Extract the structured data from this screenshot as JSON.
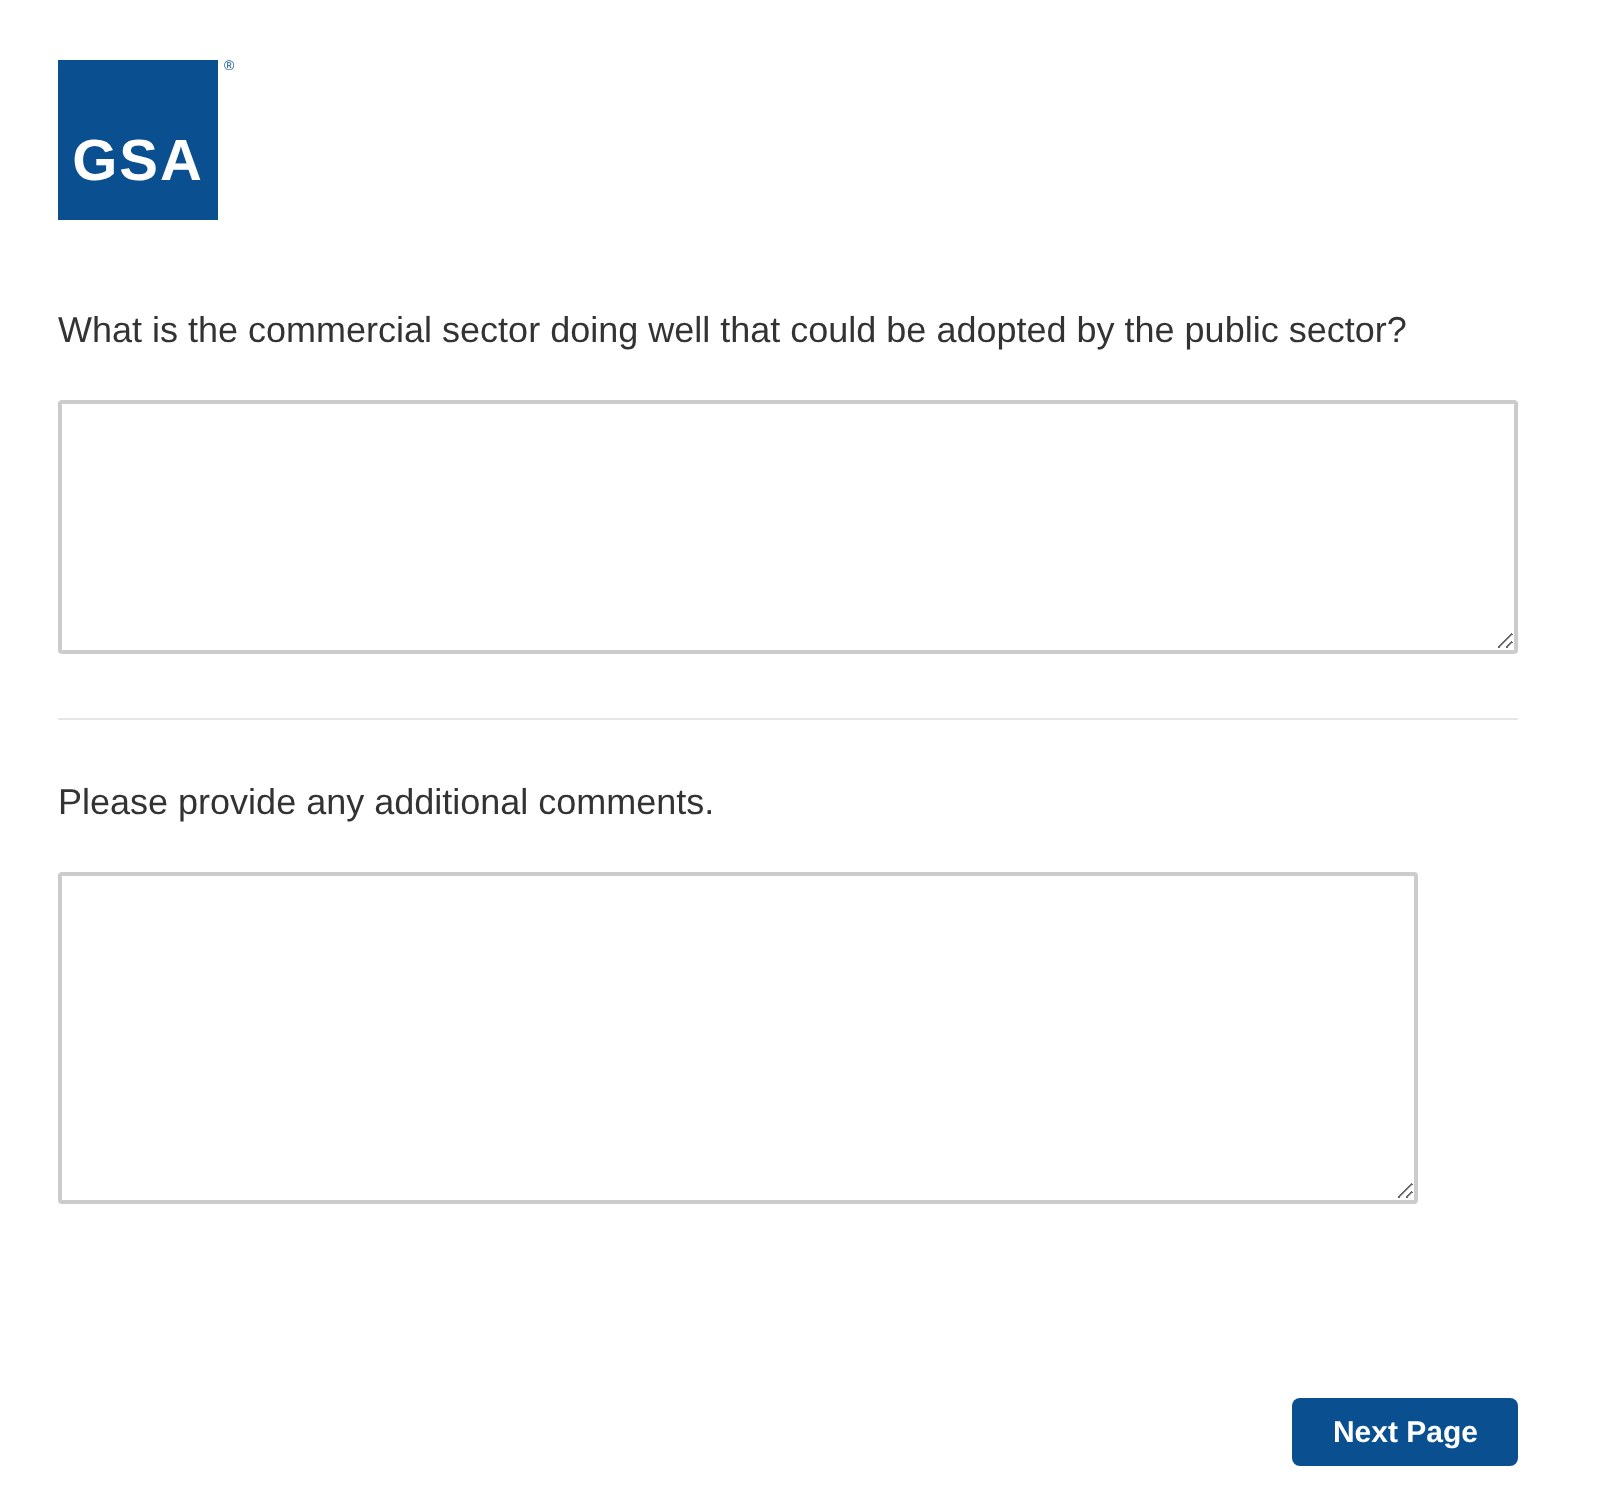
{
  "logo": {
    "text": "GSA",
    "mark": "®"
  },
  "questions": [
    {
      "label": "What is the commercial sector doing well that could be adopted by the public sector?",
      "wide": true
    },
    {
      "label": "Please provide any additional comments.",
      "wide": false
    }
  ],
  "button": "Next Page"
}
